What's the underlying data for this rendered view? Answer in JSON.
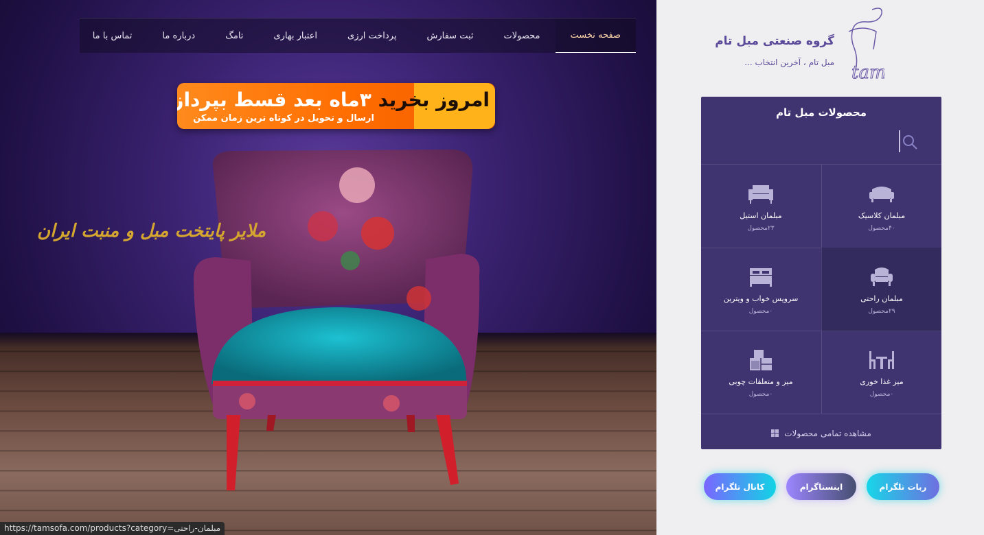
{
  "nav": {
    "items": [
      "صفحه نخست",
      "محصولات",
      "ثبت سفارش",
      "پرداخت ارزی",
      "اعتبار بهاری",
      "تامگ",
      "درباره ما",
      "تماس با ما"
    ],
    "active_index": 0
  },
  "banner": {
    "title_dark": "امروز بخرید",
    "title_light": "۳ماه",
    "title_rest": "بعد قسط بپردازید",
    "subtitle": "ارسال و تحویل در کوتاه ترین زمان ممکن"
  },
  "slogan": "ملایر پایتخت مبل و منبت ایران",
  "brand": {
    "title": "گروه صنعتی مبل تام",
    "subtitle": "مبل تام ، آخرین انتخاب ..."
  },
  "products_panel": {
    "title": "محصولات مبل تام",
    "search_placeholder": "",
    "categories": [
      {
        "label": "مبلمان کلاسیک",
        "count": "۴۰محصول",
        "icon": "classic-sofa-icon"
      },
      {
        "label": "مبلمان استیل",
        "count": "۲۳محصول",
        "icon": "steel-sofa-icon"
      },
      {
        "label": "مبلمان راحتی",
        "count": "۲۹محصول",
        "icon": "armchair-icon"
      },
      {
        "label": "سرویس خواب و ویترین",
        "count": "۰محصول",
        "icon": "bed-icon"
      },
      {
        "label": "میز غذا خوری",
        "count": "۰محصول",
        "icon": "dining-table-icon"
      },
      {
        "label": "میز و متعلقات چوبی",
        "count": "۰محصول",
        "icon": "cabinet-icon"
      }
    ],
    "view_all": "مشاهده تمامی محصولات"
  },
  "social": {
    "telegram_bot": "ربات تلگرام",
    "instagram": "اینستاگرام",
    "telegram_channel": "کانال تلگرام"
  },
  "status_bar": "https://tamsofa.com/products?category=مبلمان-راحتی",
  "colors": {
    "panel": "#3f3470",
    "accent_text": "#5b4a9a",
    "active_nav": "#ffd8a8",
    "banner_orange": "#ff6d00"
  }
}
